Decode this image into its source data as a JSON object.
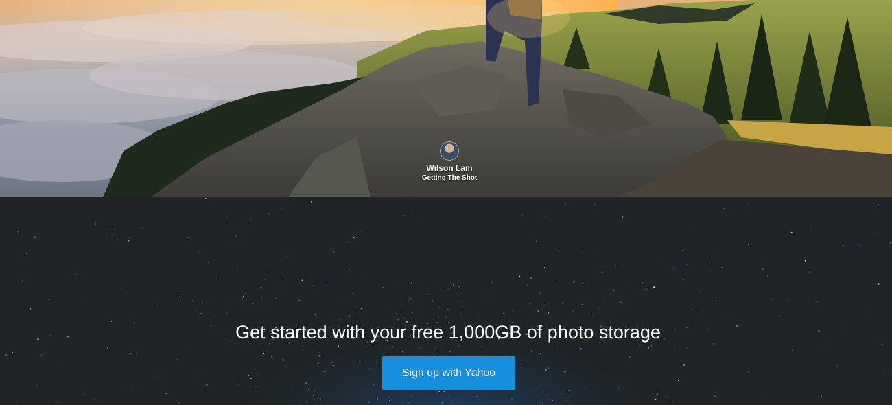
{
  "hero": {
    "photographer_name": "Wilson Lam",
    "photo_title": "Getting The Shot"
  },
  "promo": {
    "headline": "Get started with your free 1,000GB of photo storage",
    "signup_label": "Sign up with Yahoo"
  },
  "colors": {
    "signup_button": "#188fdc",
    "background": "#1f2426"
  }
}
